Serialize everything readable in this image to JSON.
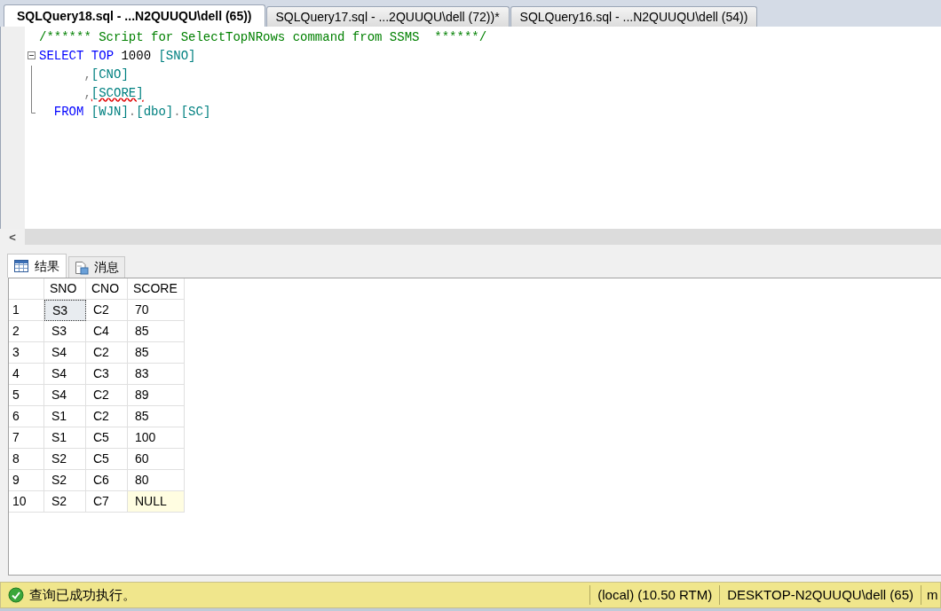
{
  "tabs": [
    {
      "label": "SQLQuery18.sql - ...N2QUUQU\\dell (65))",
      "selected": true
    },
    {
      "label": "SQLQuery17.sql - ...2QUUQU\\dell (72))*",
      "selected": false
    },
    {
      "label": "SQLQuery16.sql - ...N2QUUQU\\dell (54))",
      "selected": false
    }
  ],
  "editor": {
    "lines": [
      {
        "kind": "plain",
        "tokens": [
          {
            "kind": "comment",
            "text": "/****** Script for SelectTopNRows command from SSMS  ******/",
            "squiggle": false
          }
        ]
      },
      {
        "kind": "start",
        "tokens": [
          {
            "kind": "keyword",
            "text": "SELECT",
            "squiggle": false
          },
          {
            "kind": "keyword",
            "text": " TOP",
            "squiggle": false
          },
          {
            "kind": "number",
            "text": " 1000",
            "squiggle": false
          },
          {
            "kind": "ident",
            "text": " [SNO]",
            "squiggle": false
          }
        ]
      },
      {
        "kind": "body",
        "tokens": [
          {
            "kind": "punct",
            "text": "      ,",
            "squiggle": false
          },
          {
            "kind": "ident",
            "text": "[CNO]",
            "squiggle": false
          }
        ]
      },
      {
        "kind": "body",
        "tokens": [
          {
            "kind": "punct",
            "text": "      ,",
            "squiggle": false
          },
          {
            "kind": "ident",
            "text": "[SCORE]",
            "squiggle": true
          }
        ]
      },
      {
        "kind": "end",
        "tokens": [
          {
            "kind": "keyword",
            "text": "  FROM",
            "squiggle": false
          },
          {
            "kind": "ident",
            "text": " [WJN]",
            "squiggle": false
          },
          {
            "kind": "punct",
            "text": ".",
            "squiggle": false
          },
          {
            "kind": "ident",
            "text": "[dbo]",
            "squiggle": false
          },
          {
            "kind": "punct",
            "text": ".",
            "squiggle": false
          },
          {
            "kind": "ident",
            "text": "[SC]",
            "squiggle": false
          }
        ]
      }
    ]
  },
  "scroll_left": "<",
  "result_tabs": [
    {
      "label": "结果",
      "kind": "grid",
      "selected": true
    },
    {
      "label": "消息",
      "kind": "messages",
      "selected": false
    }
  ],
  "grid": {
    "columns": [
      "SNO",
      "CNO",
      "SCORE"
    ],
    "rows": [
      {
        "number": "1",
        "cells": [
          {
            "text": "S3",
            "focused": true,
            "kind": "value"
          },
          {
            "text": "C2",
            "focused": false,
            "kind": "value"
          },
          {
            "text": "70",
            "focused": false,
            "kind": "value"
          }
        ]
      },
      {
        "number": "2",
        "cells": [
          {
            "text": "S3",
            "focused": false,
            "kind": "value"
          },
          {
            "text": "C4",
            "focused": false,
            "kind": "value"
          },
          {
            "text": "85",
            "focused": false,
            "kind": "value"
          }
        ]
      },
      {
        "number": "3",
        "cells": [
          {
            "text": "S4",
            "focused": false,
            "kind": "value"
          },
          {
            "text": "C2",
            "focused": false,
            "kind": "value"
          },
          {
            "text": "85",
            "focused": false,
            "kind": "value"
          }
        ]
      },
      {
        "number": "4",
        "cells": [
          {
            "text": "S4",
            "focused": false,
            "kind": "value"
          },
          {
            "text": "C3",
            "focused": false,
            "kind": "value"
          },
          {
            "text": "83",
            "focused": false,
            "kind": "value"
          }
        ]
      },
      {
        "number": "5",
        "cells": [
          {
            "text": "S4",
            "focused": false,
            "kind": "value"
          },
          {
            "text": "C2",
            "focused": false,
            "kind": "value"
          },
          {
            "text": "89",
            "focused": false,
            "kind": "value"
          }
        ]
      },
      {
        "number": "6",
        "cells": [
          {
            "text": "S1",
            "focused": false,
            "kind": "value"
          },
          {
            "text": "C2",
            "focused": false,
            "kind": "value"
          },
          {
            "text": "85",
            "focused": false,
            "kind": "value"
          }
        ]
      },
      {
        "number": "7",
        "cells": [
          {
            "text": "S1",
            "focused": false,
            "kind": "value"
          },
          {
            "text": "C5",
            "focused": false,
            "kind": "value"
          },
          {
            "text": "100",
            "focused": false,
            "kind": "value"
          }
        ]
      },
      {
        "number": "8",
        "cells": [
          {
            "text": "S2",
            "focused": false,
            "kind": "value"
          },
          {
            "text": "C5",
            "focused": false,
            "kind": "value"
          },
          {
            "text": "60",
            "focused": false,
            "kind": "value"
          }
        ]
      },
      {
        "number": "9",
        "cells": [
          {
            "text": "S2",
            "focused": false,
            "kind": "value"
          },
          {
            "text": "C6",
            "focused": false,
            "kind": "value"
          },
          {
            "text": "80",
            "focused": false,
            "kind": "value"
          }
        ]
      },
      {
        "number": "10",
        "cells": [
          {
            "text": "S2",
            "focused": false,
            "kind": "value"
          },
          {
            "text": "C7",
            "focused": false,
            "kind": "value"
          },
          {
            "text": "NULL",
            "focused": false,
            "kind": "null"
          }
        ]
      }
    ]
  },
  "status_bar": {
    "message": "查询已成功执行。",
    "server": "(local) (10.50 RTM)",
    "user": "DESKTOP-N2QUUQU\\dell (65)",
    "database": "m"
  }
}
